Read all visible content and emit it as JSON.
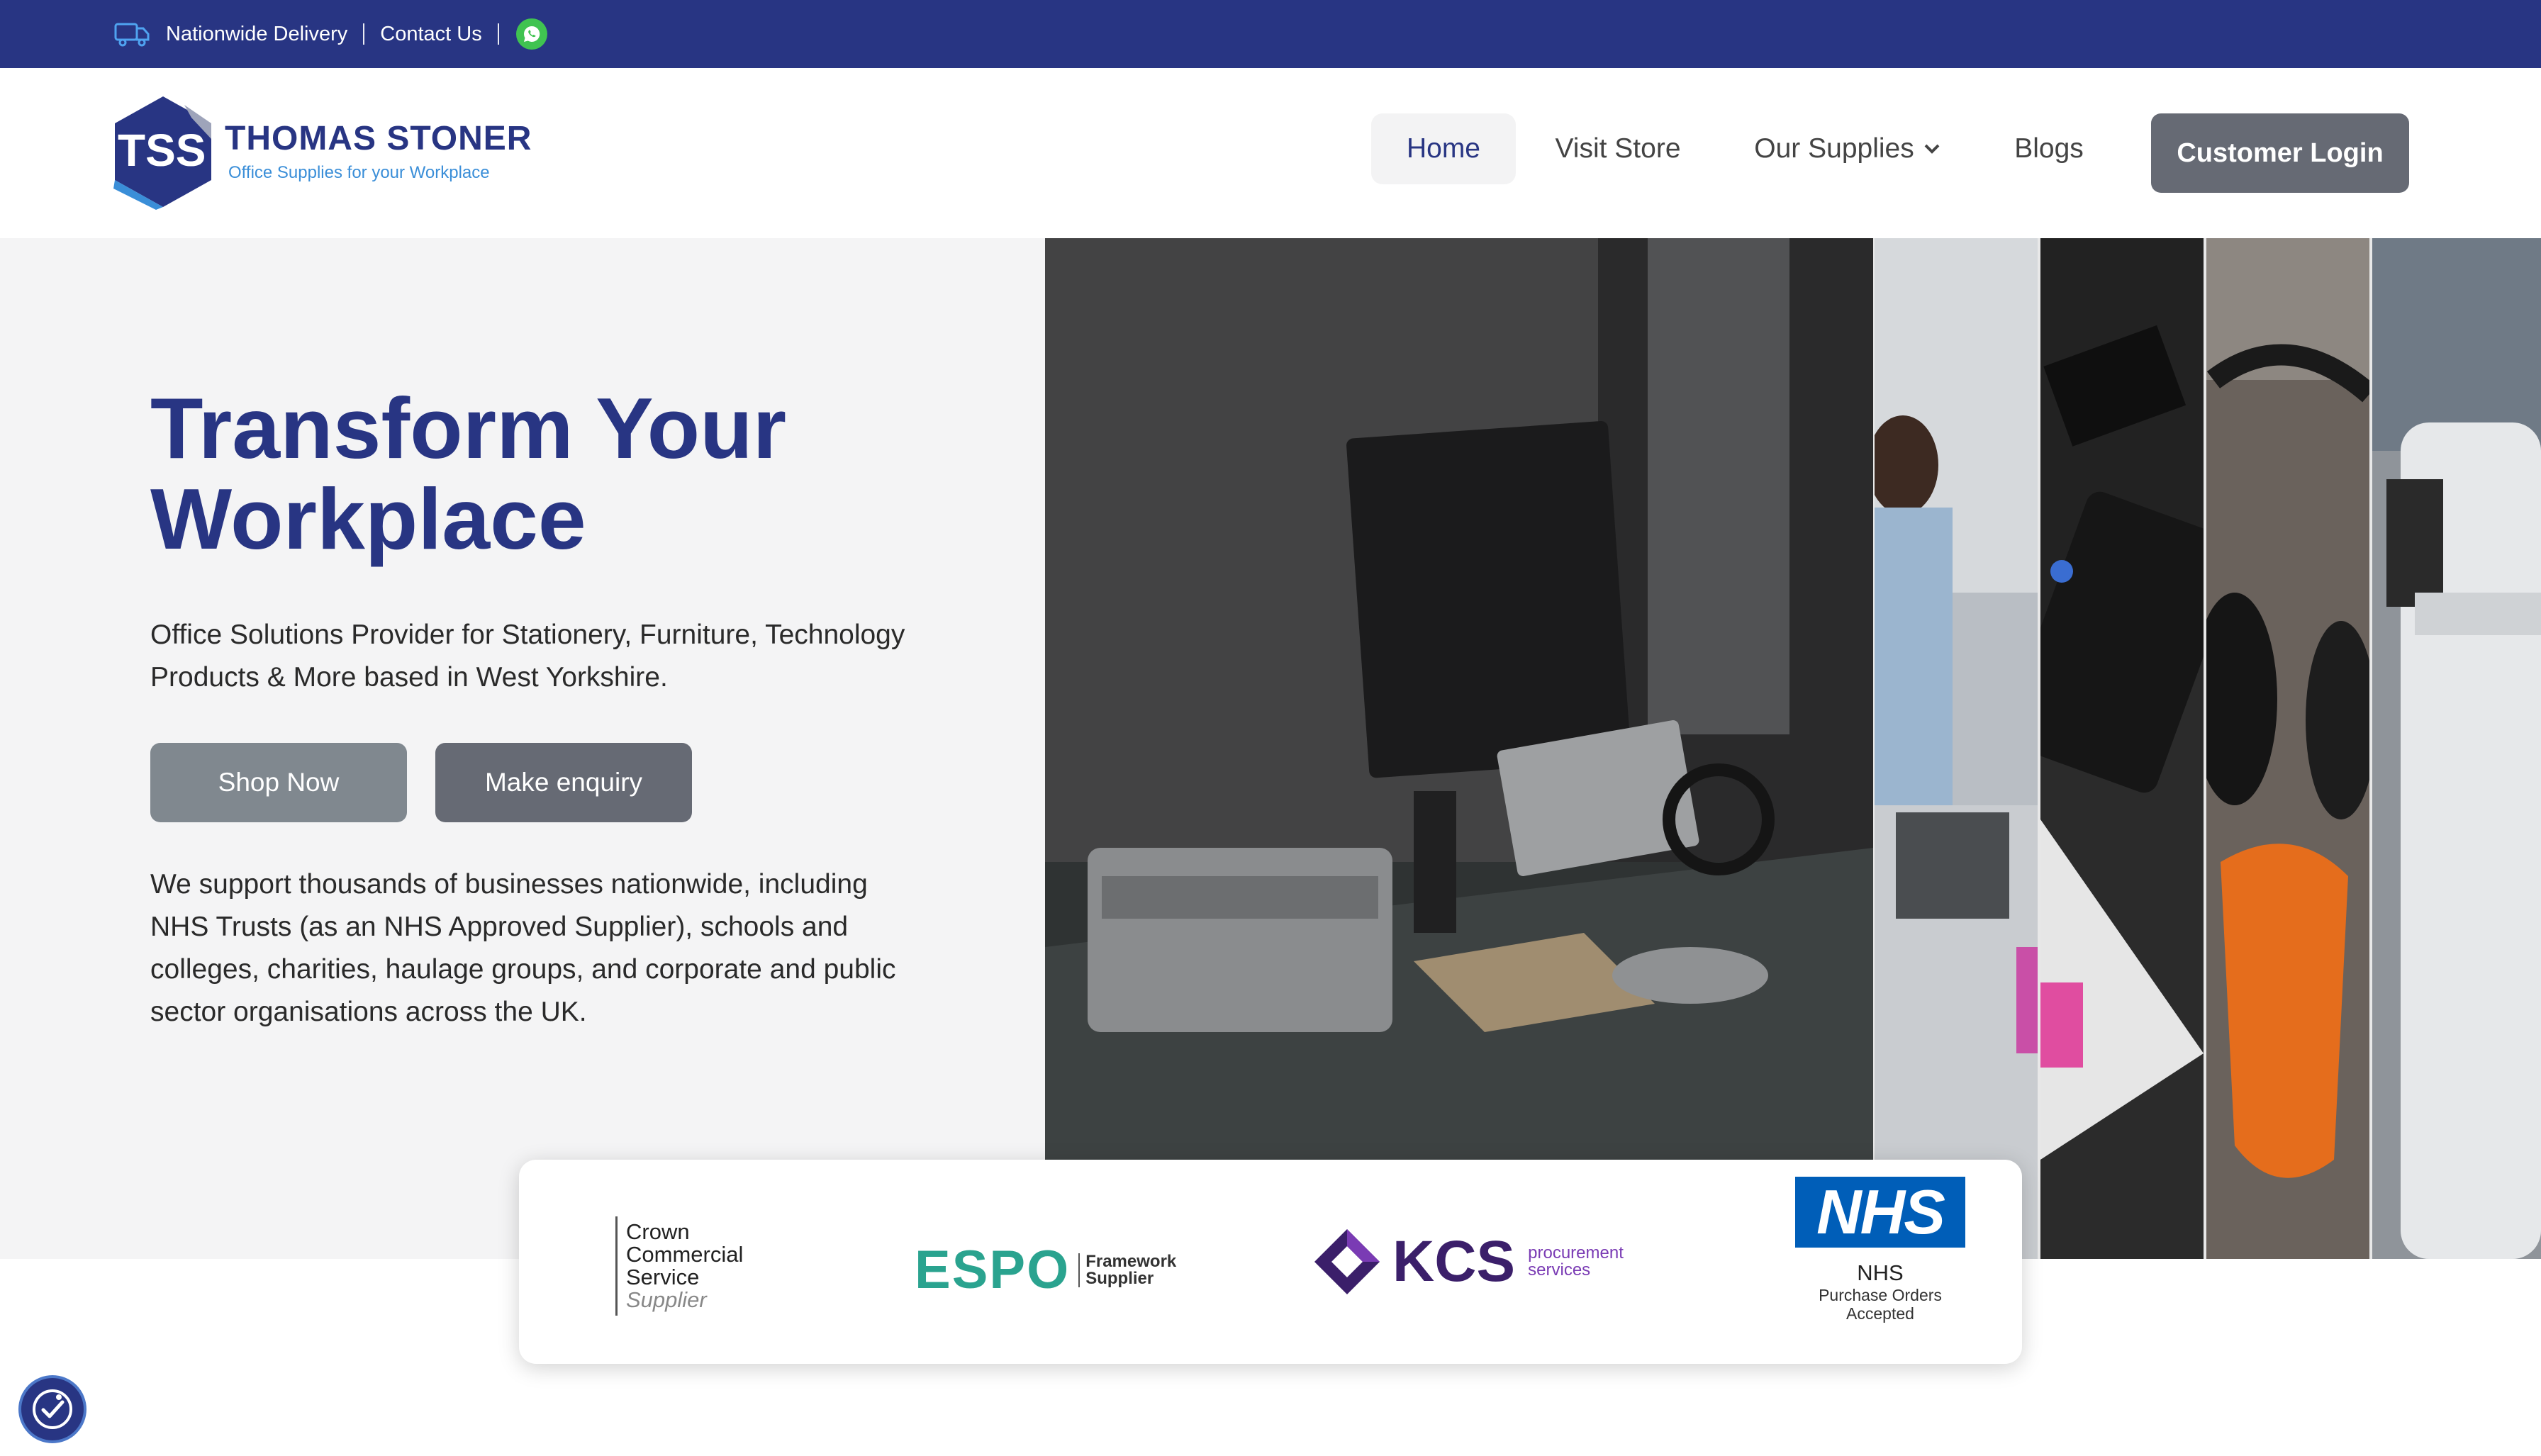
{
  "topbar": {
    "delivery": "Nationwide Delivery",
    "contact": "Contact Us",
    "icons": {
      "delivery": "truck-icon",
      "whatsapp": "whatsapp-icon"
    }
  },
  "logo": {
    "monogram": "TSS",
    "brand": "THOMAS STONER",
    "tagline": "Office Supplies for your Workplace"
  },
  "nav": {
    "items": [
      {
        "label": "Home",
        "active": true
      },
      {
        "label": "Visit Store"
      },
      {
        "label": "Our Supplies",
        "has_dropdown": true
      },
      {
        "label": "Blogs"
      }
    ],
    "login": "Customer Login"
  },
  "hero": {
    "title_line1": "Transform Your",
    "title_line2": "Workplace",
    "subtitle": "Office Solutions Provider for Stationery, Furniture, Technology Products & More based in West Yorkshire.",
    "buttons": {
      "shop": "Shop Now",
      "enquiry": "Make enquiry"
    },
    "paragraph": "We support thousands of businesses nationwide, including NHS Trusts (as an NHS Approved Supplier), schools and colleges, charities, haulage groups, and corporate and public sector organisations across the UK."
  },
  "accreditations": {
    "ccs": {
      "l1": "Crown",
      "l2": "Commercial",
      "l3": "Service",
      "l4": "Supplier"
    },
    "espo": {
      "name": "ESPO",
      "l1": "Framework",
      "l2": "Supplier"
    },
    "kcs": {
      "name": "KCS",
      "l1": "procurement",
      "l2": "services"
    },
    "nhs": {
      "logo": "NHS",
      "title": "NHS",
      "caption": "Purchase Orders Accepted"
    }
  },
  "colors": {
    "brand_navy": "#283583",
    "button_grey": "#666a74",
    "button_light_grey": "#80888f",
    "nhs_blue": "#005eb8",
    "espo_teal": "#2aa38f"
  }
}
